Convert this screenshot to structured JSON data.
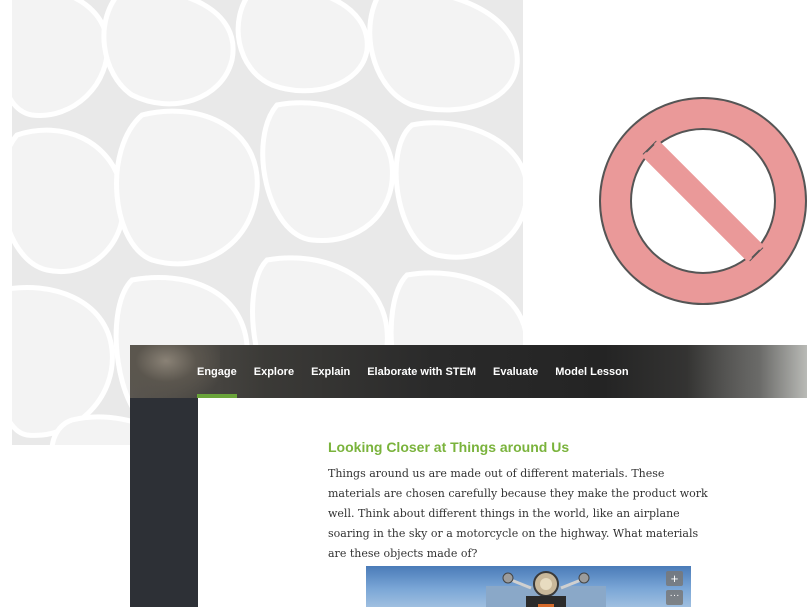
{
  "nav": {
    "tabs": [
      {
        "label": "Engage",
        "active": true
      },
      {
        "label": "Explore",
        "active": false
      },
      {
        "label": "Explain",
        "active": false
      },
      {
        "label": "Elaborate with STEM",
        "active": false
      },
      {
        "label": "Evaluate",
        "active": false
      },
      {
        "label": "Model Lesson",
        "active": false
      }
    ]
  },
  "lesson": {
    "title": "Looking Closer at Things around Us",
    "body": "Things around us are made out of different materials. These materials are chosen carefully because they make the product work well. Think about different things in the world, like an airplane soaring in the sky or a motorcycle on the highway. What materials are these objects made of?"
  },
  "image_controls": {
    "zoom": "+",
    "more": "···"
  },
  "colors": {
    "accent": "#7ab33c",
    "no_symbol_fill": "#ea9999",
    "no_symbol_stroke": "#555555",
    "rail": "#2d3036"
  },
  "icons": {
    "no_symbol": "prohibited-icon",
    "pattern": "pebble-pattern"
  }
}
